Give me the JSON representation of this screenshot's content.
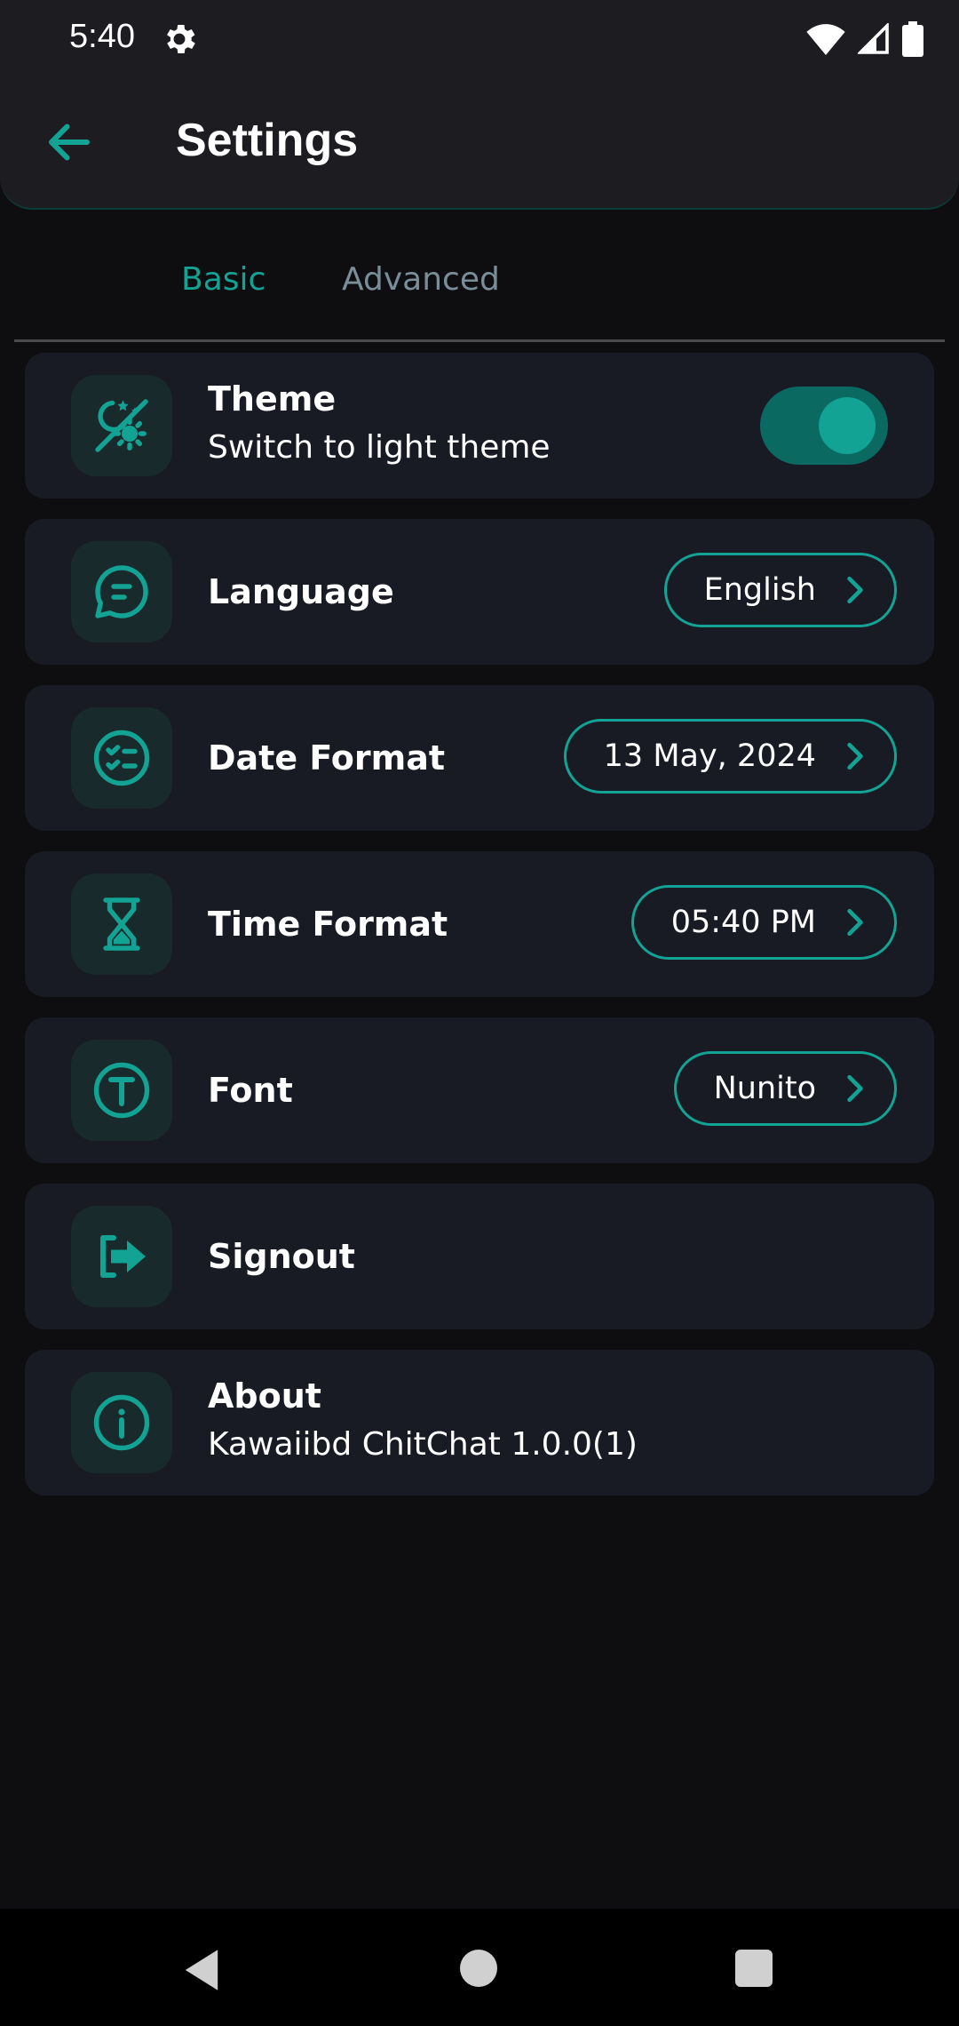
{
  "status_bar": {
    "time": "5:40"
  },
  "app_bar": {
    "title": "Settings"
  },
  "tabs": [
    {
      "label": "Basic",
      "selected": true
    },
    {
      "label": "Advanced",
      "selected": false
    }
  ],
  "settings": {
    "theme": {
      "title": "Theme",
      "subtitle": "Switch to light theme",
      "toggle_on": true
    },
    "language": {
      "title": "Language",
      "value": "English"
    },
    "date_format": {
      "title": "Date Format",
      "value": "13 May, 2024"
    },
    "time_format": {
      "title": "Time Format",
      "value": "05:40 PM"
    },
    "font": {
      "title": "Font",
      "value": "Nunito"
    },
    "signout": {
      "title": "Signout"
    },
    "about": {
      "title": "About",
      "subtitle": "Kawaiibd ChitChat 1.0.0(1)"
    }
  },
  "colors": {
    "accent": "#12a394",
    "background": "#0e0e10",
    "card": "#181a24",
    "icon_bg": "#182a2b",
    "tab_inactive": "#7a8e99"
  },
  "icons": {
    "theme": "theme-moon-sun-icon",
    "language": "chat-bubble-icon",
    "date_format": "checklist-icon",
    "time_format": "hourglass-icon",
    "font": "letter-t-icon",
    "signout": "logout-arrow-icon",
    "about": "info-icon"
  }
}
